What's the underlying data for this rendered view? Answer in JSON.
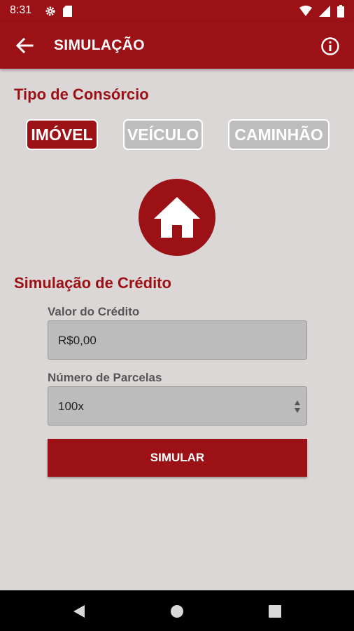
{
  "status_bar": {
    "time": "8:31",
    "icons": [
      "gear-icon",
      "sd-card-icon",
      "wifi-icon",
      "signal-icon",
      "battery-icon"
    ]
  },
  "app_bar": {
    "title": "SIMULAÇÃO",
    "back_icon": "arrow-left-icon",
    "info_icon": "info-icon"
  },
  "consorcio": {
    "title": "Tipo de Consórcio",
    "types": [
      {
        "label": "IMÓVEL",
        "selected": true
      },
      {
        "label": "VEÍCULO",
        "selected": false
      },
      {
        "label": "CAMINHÃO",
        "selected": false
      }
    ],
    "selected_icon": "house-icon"
  },
  "credito": {
    "title": "Simulação de Crédito",
    "valor_label": "Valor do Crédito",
    "valor_value": "R$0,00",
    "parcelas_label": "Número de Parcelas",
    "parcelas_value": "100x",
    "button_label": "SIMULAR"
  },
  "colors": {
    "brand": "#9b1116",
    "background": "#dcd7d7",
    "field": "#bcbcbc"
  },
  "nav": {
    "icons": [
      "back-triangle-icon",
      "home-circle-icon",
      "recents-square-icon"
    ]
  }
}
